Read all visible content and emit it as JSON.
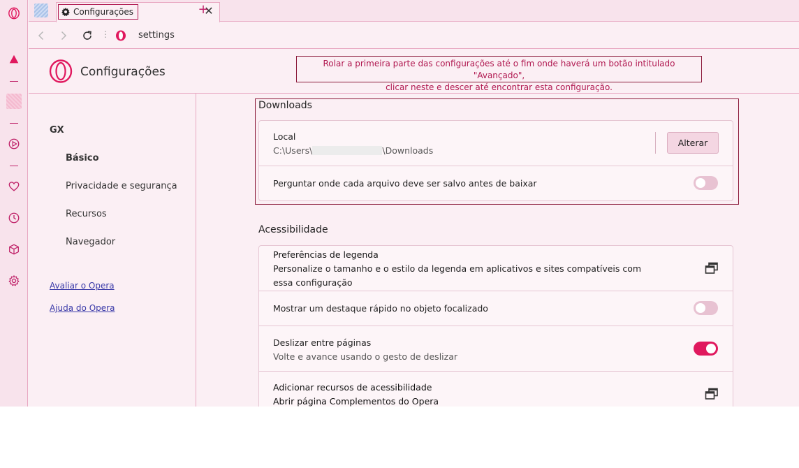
{
  "tab": {
    "title": "Configurações",
    "close_glyph": "✕",
    "new_glyph": "+"
  },
  "addressbar": {
    "url": "settings",
    "dots": "⋮"
  },
  "header": {
    "title": "Configurações",
    "annotation_line1": "Rolar a primeira parte das configurações até o fim onde haverá um botão intitulado \"Avançado\",",
    "annotation_line2": "clicar neste e descer até encontrar esta configuração."
  },
  "sidebar": {
    "section": "GX",
    "items": [
      {
        "label": "Básico",
        "active": true
      },
      {
        "label": "Privacidade e segurança",
        "active": false
      },
      {
        "label": "Recursos",
        "active": false
      },
      {
        "label": "Navegador",
        "active": false
      }
    ],
    "links": [
      "Avaliar o Opera",
      "Ajuda do Opera"
    ]
  },
  "downloads": {
    "title": "Downloads",
    "location_label": "Local",
    "location_prefix": "C:\\Users\\",
    "location_suffix": "\\Downloads",
    "change_button": "Alterar",
    "ask_label": "Perguntar onde cada arquivo deve ser salvo antes de baixar",
    "ask_enabled": false
  },
  "accessibility": {
    "title": "Acessibilidade",
    "caption_title": "Preferências de legenda",
    "caption_desc": "Personalize o tamanho e o estilo da legenda em aplicativos e sites compatíveis com essa configuração",
    "focus_label": "Mostrar um destaque rápido no objeto focalizado",
    "focus_enabled": false,
    "swipe_title": "Deslizar entre páginas",
    "swipe_desc": "Volte e avance usando o gesto de deslizar",
    "swipe_enabled": true,
    "addons_title": "Adicionar recursos de acessibilidade",
    "addons_desc": "Abrir página Complementos do Opera"
  },
  "colors": {
    "accent": "#e0185e",
    "annotation": "#b0174f",
    "background": "#fbeff4"
  },
  "icons": [
    "opera-logo-icon",
    "aria-icon",
    "player-icon",
    "heart-icon",
    "history-icon",
    "box-icon",
    "gear-icon",
    "external-link-icon"
  ]
}
